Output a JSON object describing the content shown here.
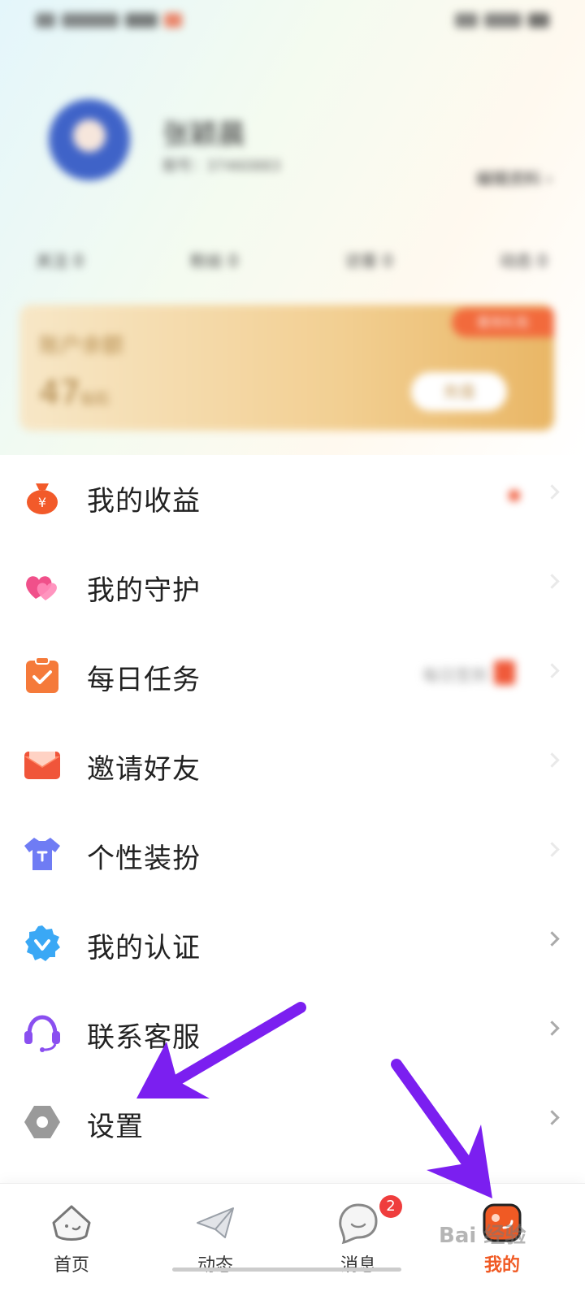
{
  "profile": {
    "name": "张颖晨",
    "id_text": "靓号：37460883",
    "edit_label": "编辑资料"
  },
  "stats": [
    {
      "label": "关注 0"
    },
    {
      "label": "粉丝 0"
    },
    {
      "label": "访客 0"
    },
    {
      "label": "动态 0"
    }
  ],
  "wallet": {
    "badge": "首充礼包",
    "title": "账户余额",
    "amount": "47",
    "unit": "钻石",
    "button": "充值"
  },
  "menu": [
    {
      "label": "我的收益",
      "icon": "money-bag-icon",
      "color": "#f25a2a"
    },
    {
      "label": "我的守护",
      "icon": "hearts-icon",
      "color": "#f0508a"
    },
    {
      "label": "每日任务",
      "icon": "clipboard-check-icon",
      "color": "#f57a3a",
      "extra": "每日签到"
    },
    {
      "label": "邀请好友",
      "icon": "envelope-icon",
      "color": "#f0553a"
    },
    {
      "label": "个性装扮",
      "icon": "tshirt-icon",
      "color": "#6f7cf4"
    },
    {
      "label": "我的认证",
      "icon": "verified-badge-icon",
      "color": "#3aa8f5"
    },
    {
      "label": "联系客服",
      "icon": "headset-icon",
      "color": "#8a4ff0"
    },
    {
      "label": "设置",
      "icon": "gear-hexagon-icon",
      "color": "#9a9a9a"
    }
  ],
  "nav": [
    {
      "label": "首页",
      "icon": "home-face-icon",
      "active": false
    },
    {
      "label": "动态",
      "icon": "paper-plane-icon",
      "active": false
    },
    {
      "label": "消息",
      "icon": "chat-bubble-icon",
      "active": false,
      "badge": "2"
    },
    {
      "label": "我的",
      "icon": "profile-tab-icon",
      "active": true
    }
  ],
  "colors": {
    "accent": "#f05a24",
    "annotation_arrow": "#7b1ff0"
  },
  "watermark": "Bai 经验"
}
